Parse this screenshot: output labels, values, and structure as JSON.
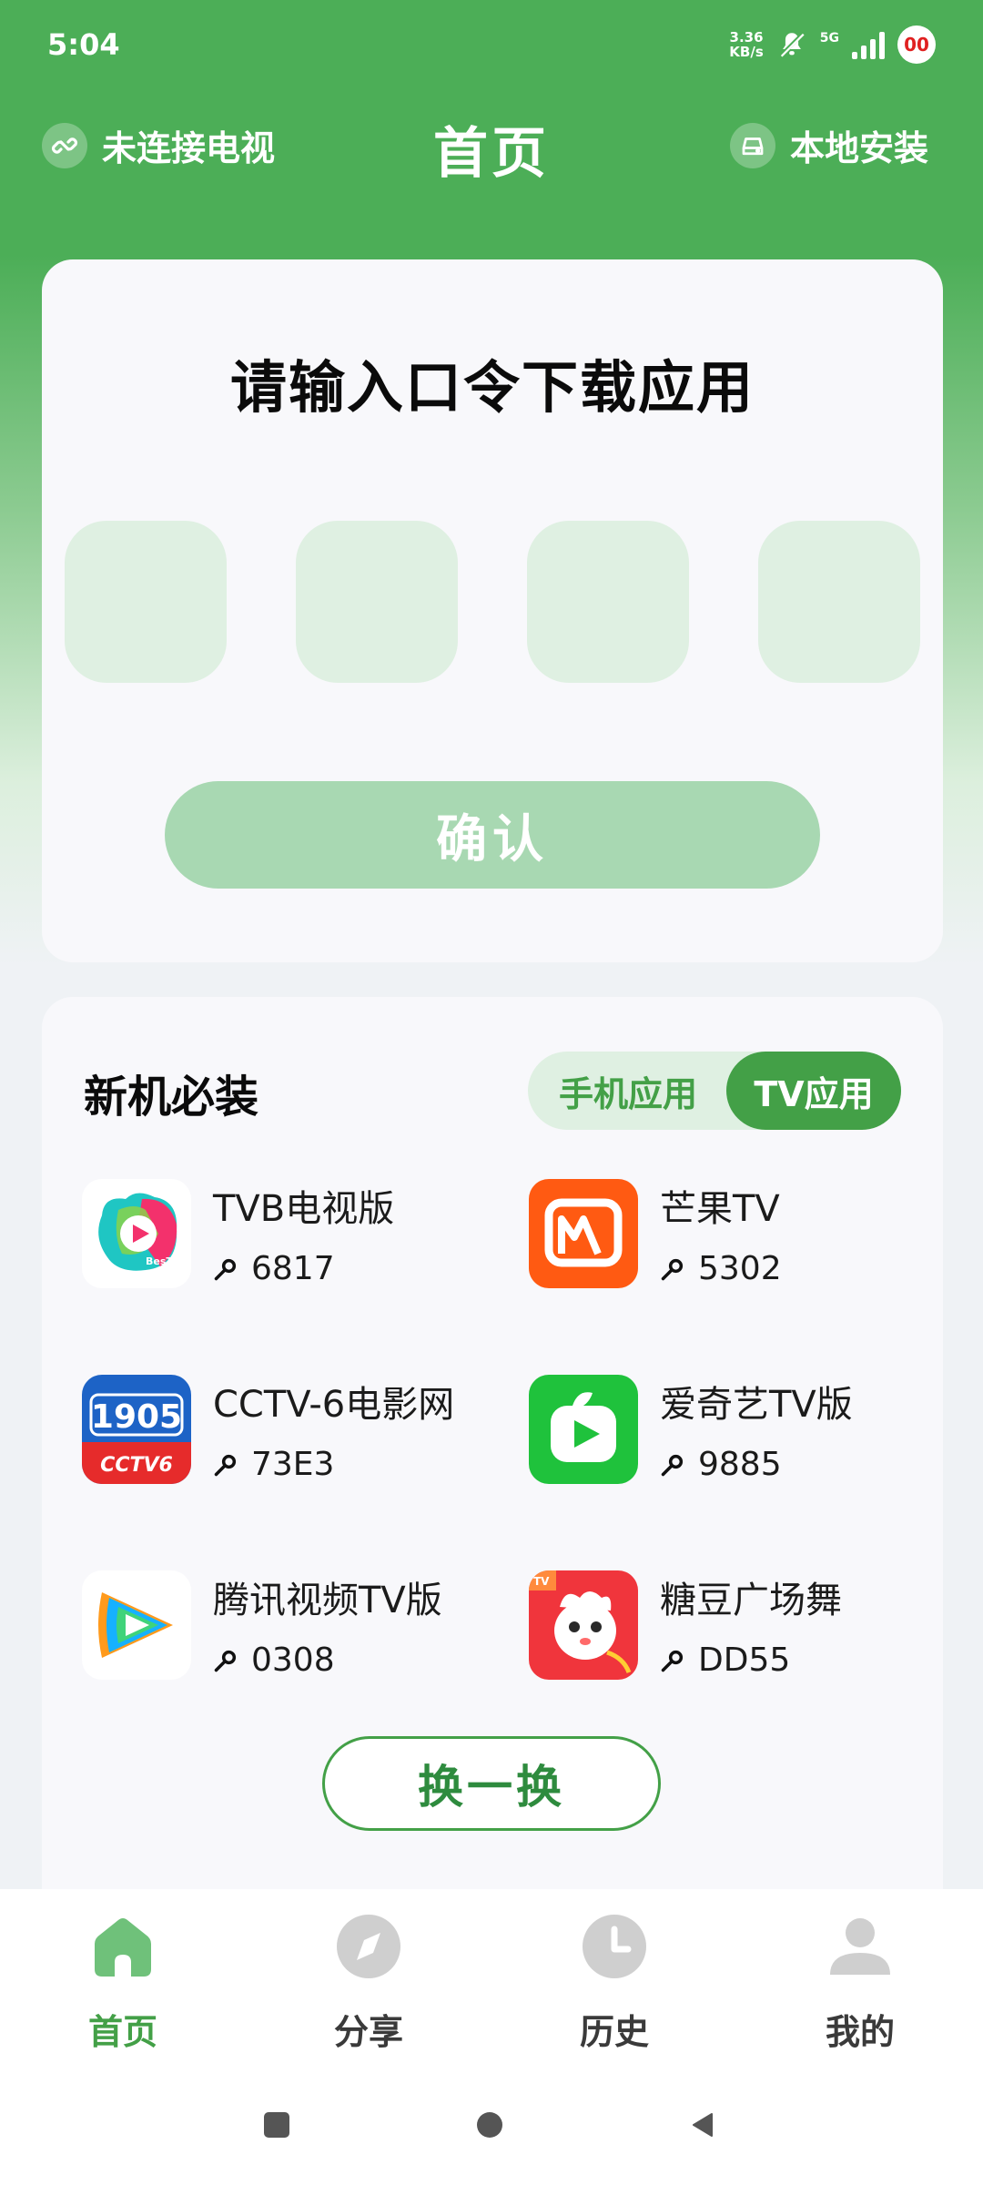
{
  "status_bar": {
    "time": "5:04",
    "net_speed_line1": "3.36",
    "net_speed_line2": "KB/s",
    "network_type": "5G",
    "battery_badge": "00"
  },
  "header": {
    "left_label": "未连接电视",
    "title": "首页",
    "right_label": "本地安装"
  },
  "code_entry": {
    "heading": "请输入口令下载应用",
    "boxes": [
      "",
      "",
      "",
      ""
    ],
    "confirm_label": "确认"
  },
  "apps_section": {
    "title": "新机必装",
    "tabs": {
      "phone": "手机应用",
      "tv": "TV应用",
      "active": "tv"
    },
    "apps": [
      {
        "name": "TVB电视版",
        "code": "6817",
        "icon": "bestv-icon"
      },
      {
        "name": "芒果TV",
        "code": "5302",
        "icon": "mango-tv-icon"
      },
      {
        "name": "CCTV-6电影网",
        "code": "73E3",
        "icon": "cctv6-1905-icon"
      },
      {
        "name": "爱奇艺TV版",
        "code": "9885",
        "icon": "iqiyi-tv-icon"
      },
      {
        "name": "腾讯视频TV版",
        "code": "0308",
        "icon": "tencent-video-icon"
      },
      {
        "name": "糖豆广场舞",
        "code": "DD55",
        "icon": "tangdou-icon"
      }
    ],
    "swap_label": "换一换"
  },
  "bottom_nav": {
    "items": [
      {
        "label": "首页",
        "icon": "home-icon",
        "active": true
      },
      {
        "label": "分享",
        "icon": "compass-icon",
        "active": false
      },
      {
        "label": "历史",
        "icon": "clock-icon",
        "active": false
      },
      {
        "label": "我的",
        "icon": "person-icon",
        "active": false
      }
    ]
  },
  "colors": {
    "primary_green": "#43a047",
    "header_green": "#4cae57",
    "code_box_bg": "#dff0e2",
    "confirm_disabled": "#a8d8b2"
  }
}
